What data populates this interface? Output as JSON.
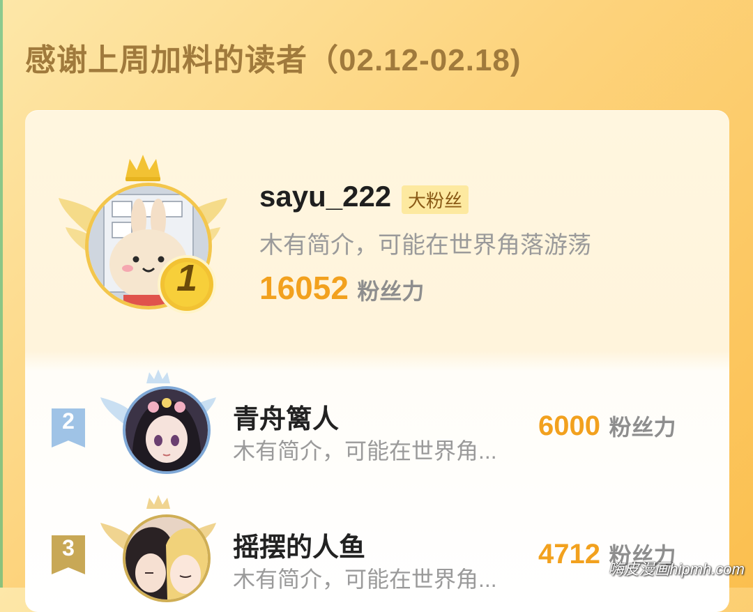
{
  "header": {
    "title": "感谢上周加料的读者（02.12-02.18)"
  },
  "colors": {
    "accent_score": "#f2a11e",
    "gold": "#f2c233",
    "silver": "#9fc3e6",
    "bronze": "#c8a856",
    "title": "#a07a3c"
  },
  "top_reader": {
    "rank": "1",
    "name": "sayu_222",
    "badge": "大粉丝",
    "bio": "木有简介，可能在世界角落游荡",
    "score": "16052",
    "score_unit": "粉丝力",
    "avatar_icon": "bunny-avatar-icon"
  },
  "readers": [
    {
      "rank": "2",
      "name": "青舟篱人",
      "bio": "木有简介，可能在世界角...",
      "score": "6000",
      "score_unit": "粉丝力",
      "avatar_icon": "girl-avatar-icon"
    },
    {
      "rank": "3",
      "name": "摇摆的人鱼",
      "bio": "木有简介，可能在世界角...",
      "score": "4712",
      "score_unit": "粉丝力",
      "avatar_icon": "couple-avatar-icon"
    }
  ],
  "watermark": "嗨皮漫画hipmh.com"
}
